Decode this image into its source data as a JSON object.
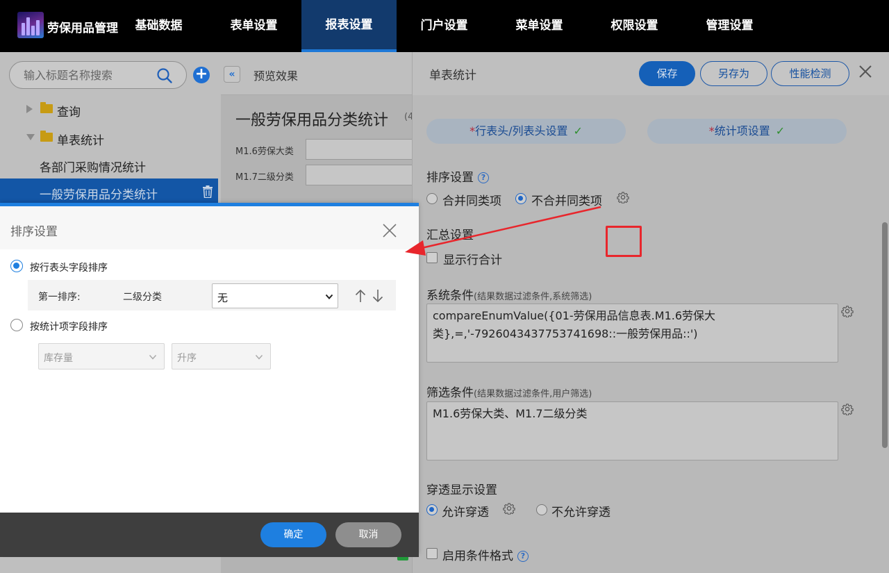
{
  "app": {
    "title": "劳保用品管理"
  },
  "nav": {
    "items": [
      {
        "label": "基础数据",
        "active": false
      },
      {
        "label": "表单设置",
        "active": false
      },
      {
        "label": "报表设置",
        "active": true
      },
      {
        "label": "门户设置",
        "active": false
      },
      {
        "label": "菜单设置",
        "active": false
      },
      {
        "label": "权限设置",
        "active": false
      },
      {
        "label": "管理设置",
        "active": false
      }
    ]
  },
  "sidebar": {
    "search_placeholder": "输入标题名称搜索",
    "tree": [
      {
        "label": "查询",
        "type": "folder",
        "expanded": false
      },
      {
        "label": "单表统计",
        "type": "folder",
        "expanded": true
      },
      {
        "label": "各部门采购情况统计",
        "type": "leaf"
      },
      {
        "label": "一般劳保用品分类统计",
        "type": "leaf",
        "selected": true
      }
    ]
  },
  "preview": {
    "header": "预览效果",
    "report_title": "一般劳保用品分类统计",
    "report_count": "(4",
    "filters": [
      {
        "label": "M1.6劳保大类"
      },
      {
        "label": "M1.7二级分类"
      }
    ]
  },
  "right_panel": {
    "title": "单表统计",
    "buttons": {
      "save": "保存",
      "save_as": "另存为",
      "perf": "性能检测"
    },
    "tabs": [
      {
        "required": "*",
        "label": "行表头/列表头设置",
        "check": "✓"
      },
      {
        "required": "*",
        "label": "统计项设置",
        "check": "✓"
      }
    ],
    "sort": {
      "label": "排序设置",
      "help": "?",
      "options": [
        {
          "label": "合并同类项",
          "selected": false
        },
        {
          "label": "不合并同类项",
          "selected": true
        }
      ]
    },
    "summary": {
      "label": "汇总设置",
      "checkbox_label": "显示行合计",
      "checked": false
    },
    "system_condition": {
      "label": "系统条件",
      "hint": "(结果数据过滤条件,系统筛选)",
      "value": "compareEnumValue({01-劳保用品信息表.M1.6劳保大类},=,'-7926043437753741698::一般劳保用品::')"
    },
    "filter_condition": {
      "label": "筛选条件",
      "hint": "(结果数据过滤条件,用户筛选)",
      "value": "M1.6劳保大类、M1.7二级分类"
    },
    "drill": {
      "label": "穿透显示设置",
      "options": [
        {
          "label": "允许穿透",
          "selected": true
        },
        {
          "label": "不允许穿透",
          "selected": false
        }
      ]
    },
    "conditional_format": {
      "label": "启用条件格式",
      "checked": false,
      "help": "?"
    }
  },
  "dialog": {
    "title": "排序设置",
    "option1": {
      "label": "按行表头字段排序",
      "selected": true
    },
    "row": {
      "label": "第一排序:",
      "field": "二级分类",
      "select_value": "无"
    },
    "option2": {
      "label": "按统计项字段排序",
      "selected": false
    },
    "disabled_selects": {
      "field": "库存量",
      "order": "升序"
    },
    "buttons": {
      "ok": "确定",
      "cancel": "取消"
    }
  },
  "colors": {
    "nav_active": "#123a6d",
    "accent_blue": "#1e7fe0",
    "highlight_red": "#e8262c",
    "check_green": "#2f8f2f"
  }
}
